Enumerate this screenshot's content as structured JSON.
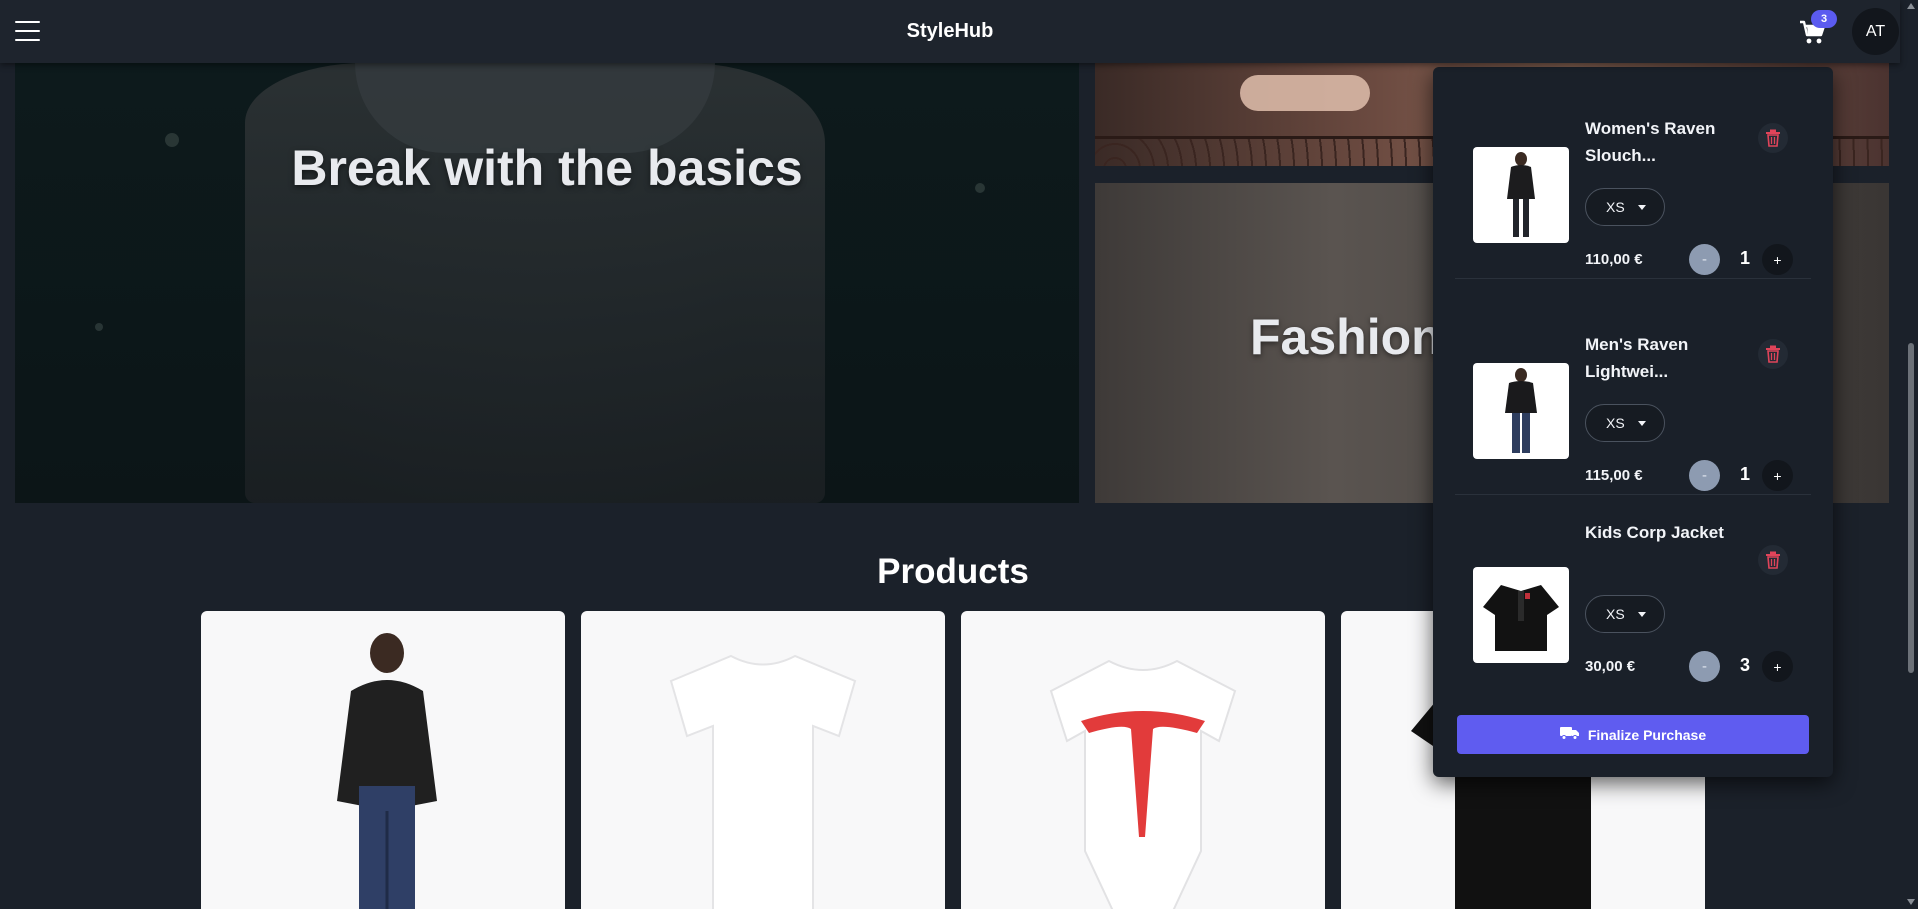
{
  "header": {
    "brand": "StyleHub",
    "cart_count": "3",
    "avatar_initials": "AT",
    "icons": [
      "menu-icon",
      "cart-icon"
    ]
  },
  "hero": {
    "main_title": "Break with the basics",
    "secondary_title": "Fashion"
  },
  "products": {
    "title": "Products",
    "cards": [
      {
        "image": "black-hoodie-model"
      },
      {
        "image": "white-tshirt"
      },
      {
        "image": "tesla-baby-onesie"
      },
      {
        "image": "black-jacket"
      }
    ]
  },
  "cart": {
    "items": [
      {
        "name": "Women's Raven Slouch...",
        "size": "XS",
        "price": "110,00 €",
        "quantity": "1",
        "minus": "-",
        "plus": "+"
      },
      {
        "name": "Men's Raven Lightwei...",
        "size": "XS",
        "price": "115,00 €",
        "quantity": "1",
        "minus": "-",
        "plus": "+"
      },
      {
        "name": "Kids Corp Jacket",
        "size": "XS",
        "price": "30,00 €",
        "quantity": "3",
        "minus": "-",
        "plus": "+"
      }
    ],
    "finalize_label": "Finalize Purchase",
    "icons": [
      "trash-icon",
      "truck-icon",
      "chevron-down-icon"
    ]
  },
  "colors": {
    "background": "#1b212a",
    "accent": "#5f5cf0",
    "badge": "#5b5bf0",
    "trash": "#e0445a"
  }
}
